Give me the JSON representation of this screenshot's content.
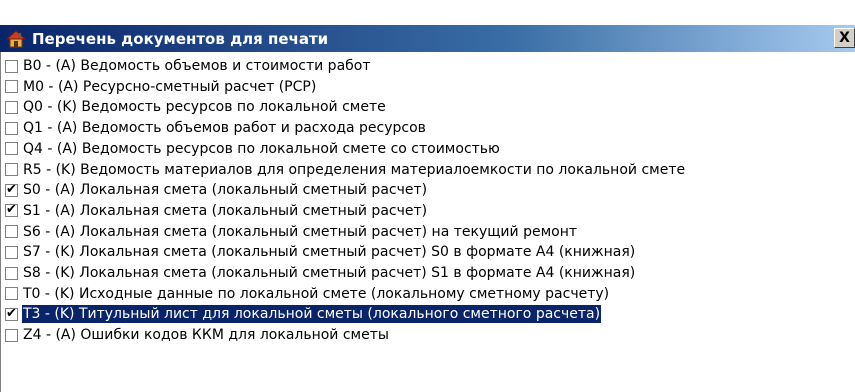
{
  "window": {
    "title": "Перечень документов для печати",
    "close_label": "X",
    "icon": "house-icon"
  },
  "items": [
    {
      "label": "B0 - (A) Ведомость объемов и стоимости работ",
      "checked": false
    },
    {
      "label": "M0 - (A) Ресурсно-сметный расчет (РСР)",
      "checked": false
    },
    {
      "label": "Q0 - (K) Ведомость ресурсов по локальной смете",
      "checked": false
    },
    {
      "label": "Q1 - (A) Ведомость объемов работ и расхода ресурсов",
      "checked": false
    },
    {
      "label": "Q4 - (A) Ведомость ресурсов по локальной смете со стоимостью",
      "checked": false
    },
    {
      "label": "R5 - (K) Ведомость материалов для определения материалоемкости по локальной смете",
      "checked": false
    },
    {
      "label": "S0 - (A) Локальная смета (локальный сметный расчет)",
      "checked": true
    },
    {
      "label": "S1 - (A) Локальная смета (локальный сметный расчет)",
      "checked": true
    },
    {
      "label": "S6 - (A) Локальная смета (локальный сметный расчет) на текущий ремонт",
      "checked": false
    },
    {
      "label": "S7 - (K) Локальная смета (локальный сметный расчет) S0 в формате A4 (книжная)",
      "checked": false
    },
    {
      "label": "S8 - (K) Локальная смета (локальный сметный расчет) S1 в формате A4 (книжная)",
      "checked": false
    },
    {
      "label": "T0 - (K) Исходные данные по локальной смете (локальному сметному расчету)",
      "checked": false
    },
    {
      "label": "T3 - (K) Титульный лист для локальной сметы (локального сметного расчета)",
      "checked": true,
      "selected": true
    },
    {
      "label": "Z4 - (A) Ошибки кодов ККМ для локальной сметы",
      "checked": false
    }
  ],
  "colors": {
    "title_start": "#0a246a",
    "title_end": "#a6caf0",
    "selection": "#0a246a"
  }
}
